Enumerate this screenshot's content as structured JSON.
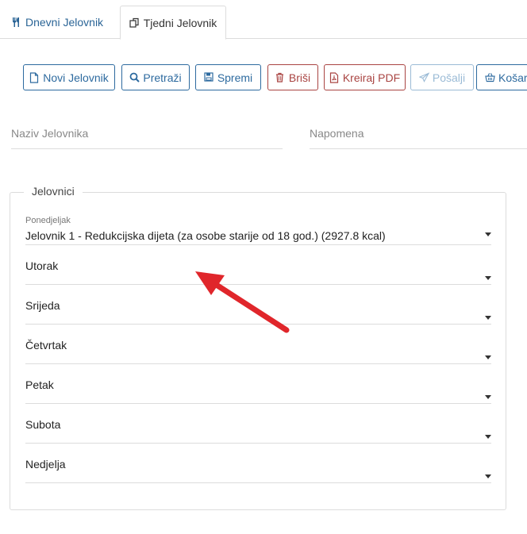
{
  "tabs": [
    {
      "label": "Dnevni Jelovnik",
      "icon": "utensils-icon"
    },
    {
      "label": "Tjedni Jelovnik",
      "icon": "copy-icon"
    }
  ],
  "toolbar": {
    "new_label": "Novi Jelovnik",
    "search_label": "Pretraži",
    "save_label": "Spremi",
    "delete_label": "Briši",
    "pdf_label": "Kreiraj PDF",
    "send_label": "Pošalji",
    "cart_label": "Košar"
  },
  "form": {
    "name_placeholder": "Naziv Jelovnika",
    "note_placeholder": "Napomena"
  },
  "menus": {
    "legend": "Jelovnici",
    "days": [
      {
        "label": "Ponedjeljak",
        "value": "Jelovnik 1 - Redukcijska dijeta (za osobe starije od 18 god.) (2927.8 kcal)"
      },
      {
        "label": "Utorak",
        "value": ""
      },
      {
        "label": "Srijeda",
        "value": ""
      },
      {
        "label": "Četvrtak",
        "value": ""
      },
      {
        "label": "Petak",
        "value": ""
      },
      {
        "label": "Subota",
        "value": ""
      },
      {
        "label": "Nedjelja",
        "value": ""
      }
    ]
  },
  "colors": {
    "primary": "#2d6a9f",
    "danger": "#a94442",
    "annotation_arrow": "#e0262b"
  }
}
